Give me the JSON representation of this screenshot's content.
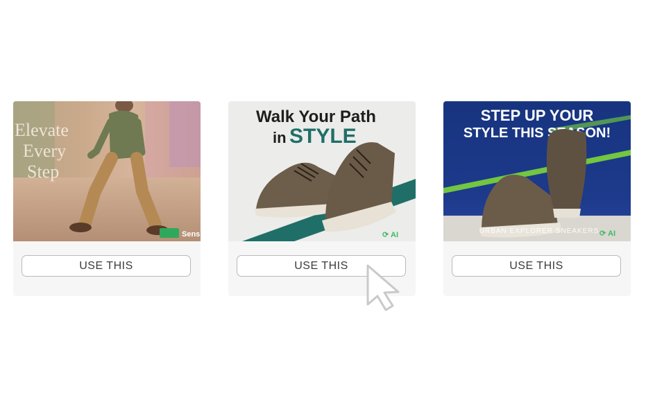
{
  "templates": [
    {
      "headline_lines": [
        "Elevate",
        "Every",
        "Step"
      ],
      "brand": "Sens",
      "button_label": "USE THIS",
      "image_subject": "man-walking-in-khaki-pants"
    },
    {
      "headline_line1": "Walk Your Path",
      "headline_prefix": "in",
      "headline_emphasis": "STYLE",
      "brand": "AI",
      "button_label": "USE THIS",
      "image_subject": "brown-sneakers-on-diagonal-stripe"
    },
    {
      "headline_lines": [
        "STEP UP YOUR",
        "STYLE THIS SEASON!"
      ],
      "caption": "URBAN EXPLORER SNEAKERS",
      "brand": "AI",
      "button_label": "USE THIS",
      "image_subject": "sneakers-on-blue-background"
    }
  ],
  "colors": {
    "emphasis_teal": "#1f6f68",
    "ad3_blue": "#1d3a8c",
    "ad3_green_streak": "#7cd63a",
    "brand_green": "#3dbb63"
  }
}
